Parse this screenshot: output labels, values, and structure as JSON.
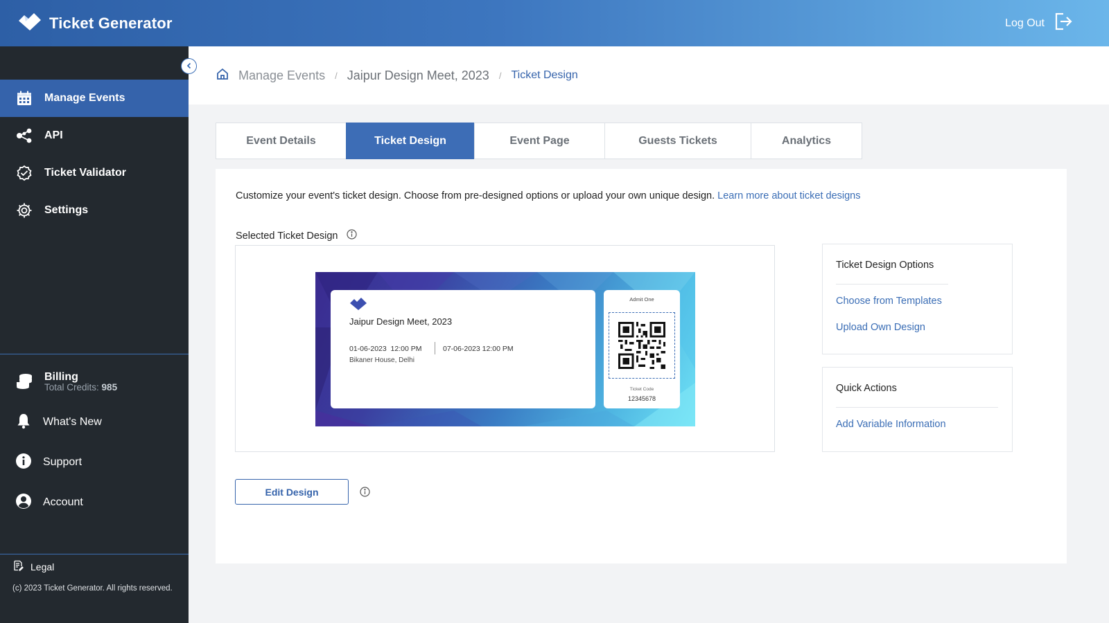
{
  "header": {
    "app_title": "Ticket Generator",
    "logout_label": "Log Out"
  },
  "sidebar": {
    "items": [
      {
        "label": "Manage Events",
        "icon": "calendar-icon",
        "active": true
      },
      {
        "label": "API",
        "icon": "share-nodes-icon"
      },
      {
        "label": "Ticket Validator",
        "icon": "badge-check-icon"
      },
      {
        "label": "Settings",
        "icon": "gear-icon"
      }
    ],
    "billing": {
      "label": "Billing",
      "credits_label": "Total Credits:",
      "credits_value": "985"
    },
    "secondary": [
      {
        "label": "What's New",
        "icon": "bell-icon"
      },
      {
        "label": "Support",
        "icon": "info-icon"
      },
      {
        "label": "Account",
        "icon": "user-circle-icon"
      }
    ],
    "legal": "Legal",
    "copyright": "(c) 2023 Ticket Generator. All rights reserved."
  },
  "breadcrumb": {
    "items": [
      "Manage Events",
      "Jaipur Design Meet, 2023",
      "Ticket Design"
    ]
  },
  "tabs": [
    "Event Details",
    "Ticket Design",
    "Event Page",
    "Guests Tickets",
    "Analytics"
  ],
  "active_tab": "Ticket Design",
  "main": {
    "description": "Customize your event's ticket design. Choose from pre-designed options or upload your own unique design.",
    "learn_more": "Learn more about ticket designs",
    "selected_label": "Selected Ticket Design",
    "edit_button": "Edit Design"
  },
  "ticket": {
    "event_name": "Jaipur Design Meet, 2023",
    "start": "01-06-2023  12:00 PM",
    "end": "07-06-2023 12:00 PM",
    "venue": "Bikaner House, Delhi",
    "admit": "Admit One",
    "code_label": "Ticket Code",
    "code": "12345678"
  },
  "options_panel": {
    "title": "Ticket Design Options",
    "links": [
      "Choose from Templates",
      "Upload Own Design"
    ]
  },
  "quick_actions": {
    "title": "Quick Actions",
    "links": [
      "Add Variable Information"
    ]
  },
  "colors": {
    "header_start": "#2d5fa6",
    "header_end": "#6bb6ea",
    "sidebar": "#23292f",
    "accent": "#3563ab",
    "link": "#3a6db5"
  }
}
